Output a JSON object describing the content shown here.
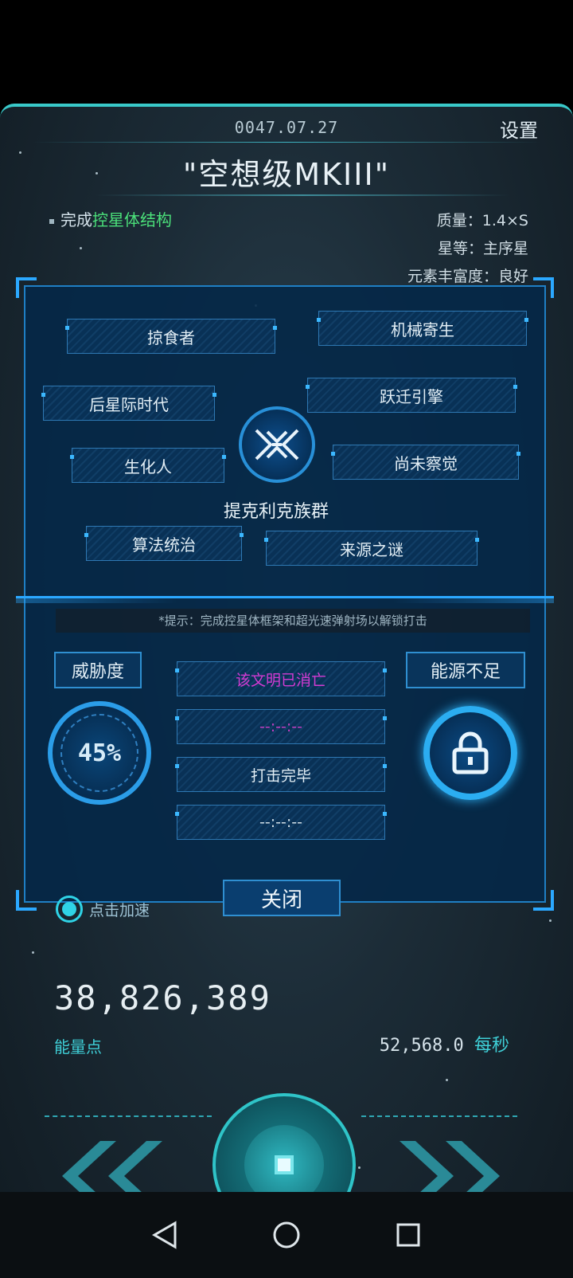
{
  "header": {
    "date": "0047.07.27",
    "settings_label": "设置",
    "title": "\"空想级MKIII\""
  },
  "task": {
    "prefix": "完成",
    "highlight": "控星体结构"
  },
  "stats": {
    "mass": "质量：1.4×S",
    "star_class": "星等：主序星",
    "abundance": "元素丰富度：良好"
  },
  "civilization": {
    "name": "提克利克族群",
    "traits": [
      "掠食者",
      "机械寄生",
      "后星际时代",
      "跃迁引擎",
      "生化人",
      "尚未察觉",
      "算法统治",
      "来源之谜"
    ]
  },
  "hint": "*提示：完成控星体框架和超光速弹射场以解锁打击",
  "threat": {
    "label": "威胁度",
    "value": "45%",
    "level_percent": 45
  },
  "energy_status": "能源不足",
  "status_rows": [
    "该文明已消亡",
    "--:--:--",
    "打击完毕",
    "--:--:--"
  ],
  "colors": {
    "extinct_text": "#d33bd3",
    "accent": "#2ba8ff",
    "green": "#4be07a",
    "teal": "#3fd0d8"
  },
  "close_label": "关闭",
  "speed_label": "点击加速",
  "energy": {
    "value": "38,826,389",
    "label": "能量点",
    "rate": "52,568.0",
    "rate_unit": "每秒"
  },
  "icons": {
    "emblem": "tiklik-emblem-icon",
    "lock": "lock-icon",
    "back": "back-icon",
    "home": "home-icon",
    "recents": "recents-icon"
  }
}
